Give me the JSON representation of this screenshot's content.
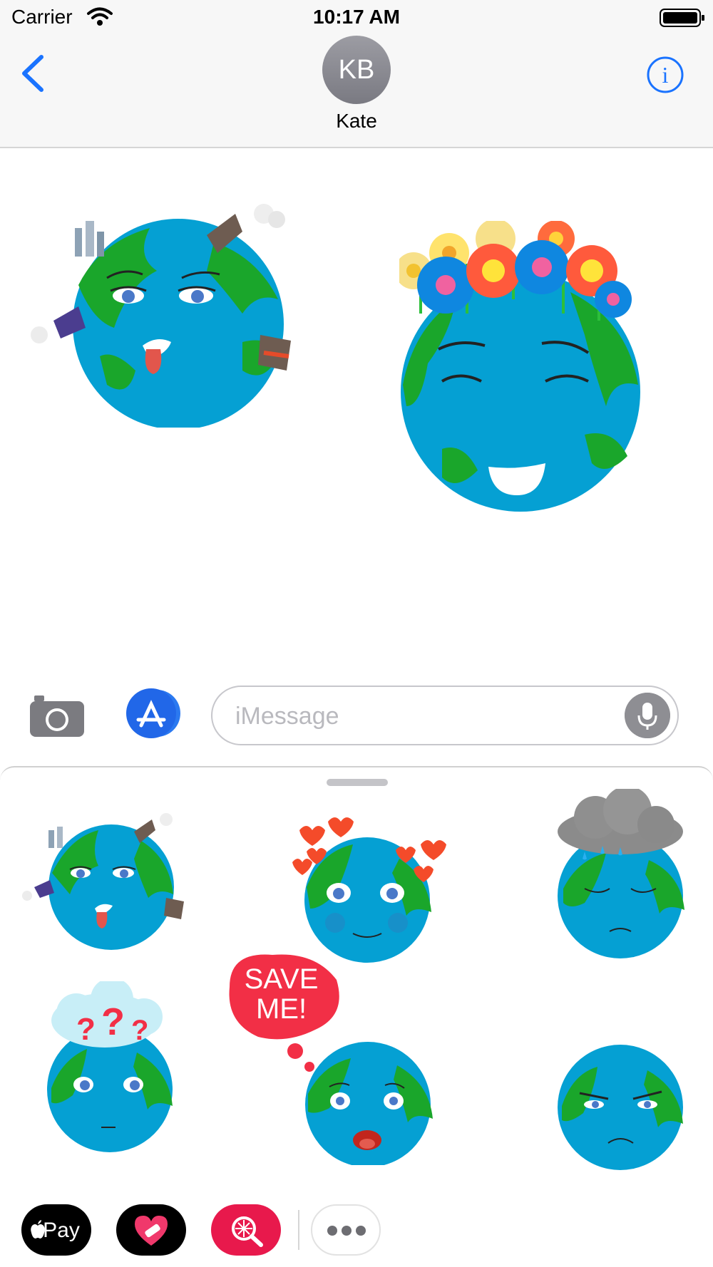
{
  "status_bar": {
    "carrier": "Carrier",
    "time": "10:17 AM",
    "icons": [
      "wifi-icon",
      "battery-icon"
    ]
  },
  "header": {
    "avatar_initials": "KB",
    "contact_name": "Kate",
    "back_icon": "chevron-left-icon",
    "info_icon": "info-icon"
  },
  "transcript": {
    "stickers": [
      "polluted-earth-sticker",
      "flower-crown-earth-sticker"
    ]
  },
  "compose": {
    "placeholder": "iMessage",
    "icons": [
      "camera-icon",
      "app-store-icon",
      "microphone-icon"
    ]
  },
  "drawer": {
    "stickers": [
      "polluted-earth-sticker",
      "in-love-earth-sticker",
      "rain-cloud-earth-sticker",
      "confused-earth-sticker",
      "save-me-earth-sticker",
      "angry-earth-sticker"
    ],
    "save_me_text_line1": "SAVE",
    "save_me_text_line2": "ME!",
    "question_marks": "???"
  },
  "app_strip": {
    "apple_pay_label": "Pay",
    "icons": [
      "apple-pay-icon",
      "heart-app-icon",
      "search-app-icon",
      "more-icon"
    ]
  },
  "colors": {
    "accent": "#1a73ff",
    "ocean": "#05a0d3",
    "land": "#1aa62b",
    "save_me_bubble": "#f22f46"
  }
}
